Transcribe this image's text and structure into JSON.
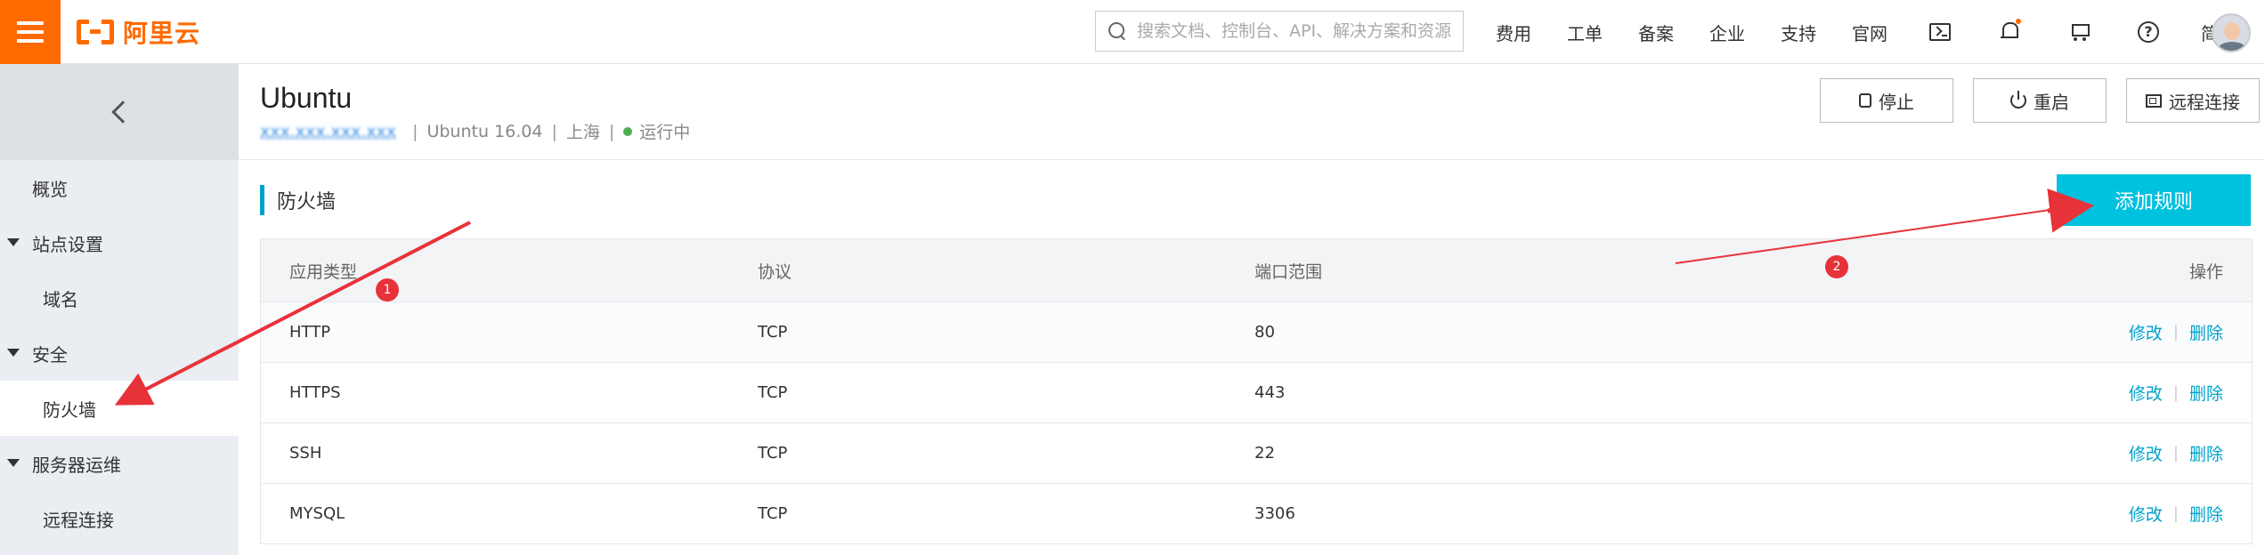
{
  "brand": {
    "name": "阿里云",
    "accent": "#ff6a00"
  },
  "search": {
    "placeholder": "搜索文档、控制台、API、解决方案和资源"
  },
  "topnav": {
    "items": [
      "费用",
      "工单",
      "备案",
      "企业",
      "支持",
      "官网"
    ],
    "lang": "简体",
    "icons": [
      "terminal-icon",
      "bell-icon",
      "cart-icon",
      "help-icon"
    ]
  },
  "sidebar": {
    "items": [
      {
        "label": "概览"
      },
      {
        "label": "站点设置"
      },
      {
        "label": "域名"
      },
      {
        "label": "安全"
      },
      {
        "label": "防火墙"
      },
      {
        "label": "服务器运维"
      },
      {
        "label": "远程连接"
      }
    ]
  },
  "instance": {
    "name": "Ubuntu",
    "os": "Ubuntu 16.04",
    "region": "上海",
    "status": "运行中",
    "buttons": {
      "stop": "停止",
      "restart": "重启",
      "remote": "远程连接"
    }
  },
  "firewall": {
    "title": "防火墙",
    "add_rule": "添加规则",
    "columns": [
      "应用类型",
      "协议",
      "端口范围",
      "操作"
    ],
    "rows": [
      {
        "app": "HTTP",
        "protocol": "TCP",
        "port": "80"
      },
      {
        "app": "HTTPS",
        "protocol": "TCP",
        "port": "443"
      },
      {
        "app": "SSH",
        "protocol": "TCP",
        "port": "22"
      },
      {
        "app": "MYSQL",
        "protocol": "TCP",
        "port": "3306"
      }
    ],
    "actions": {
      "edit": "修改",
      "delete": "删除"
    }
  },
  "annotations": {
    "badge1": "1",
    "badge2": "2",
    "color": "#e8323a"
  }
}
